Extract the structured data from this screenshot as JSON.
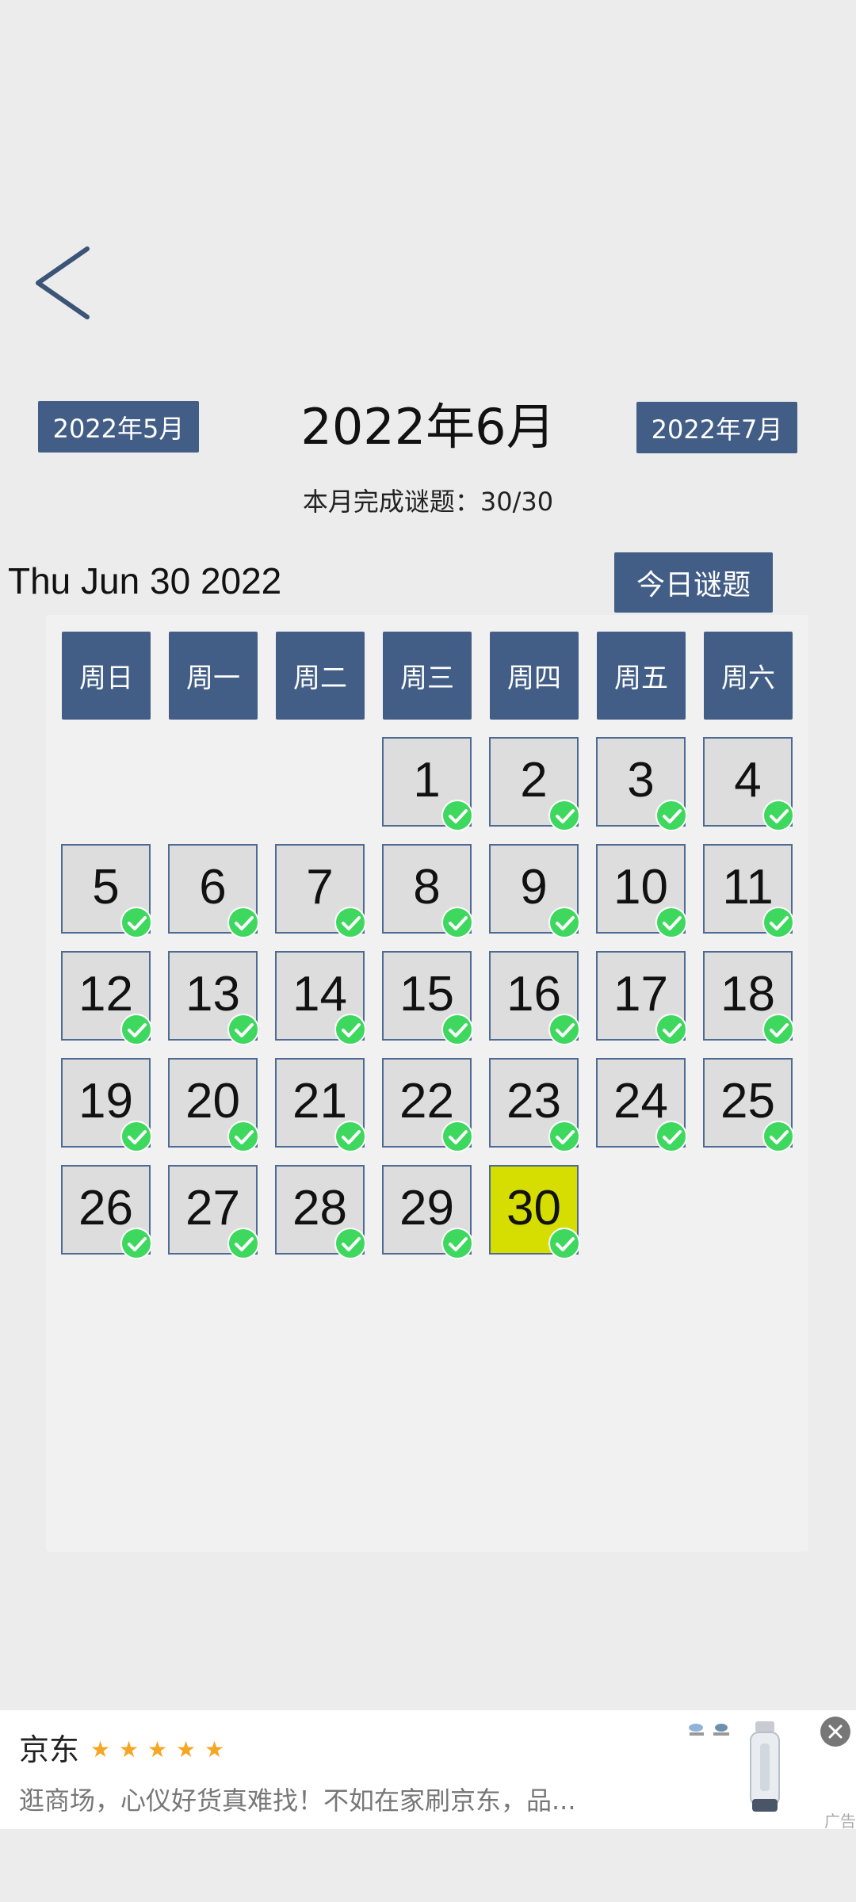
{
  "header": {
    "back_icon": "chevron-left-icon",
    "prev_month": "2022年5月",
    "next_month": "2022年7月",
    "month_title": "2022年6月",
    "progress_text": "本月完成谜题：30/30",
    "today_date": "Thu Jun 30 2022",
    "today_puzzle_button": "今日谜题"
  },
  "calendar": {
    "weekdays": [
      "周日",
      "周一",
      "周二",
      "周三",
      "周四",
      "周五",
      "周六"
    ],
    "first_weekday_index": 3,
    "days": [
      {
        "day": "1",
        "completed": true
      },
      {
        "day": "2",
        "completed": true
      },
      {
        "day": "3",
        "completed": true
      },
      {
        "day": "4",
        "completed": true
      },
      {
        "day": "5",
        "completed": true
      },
      {
        "day": "6",
        "completed": true
      },
      {
        "day": "7",
        "completed": true
      },
      {
        "day": "8",
        "completed": true
      },
      {
        "day": "9",
        "completed": true
      },
      {
        "day": "10",
        "completed": true
      },
      {
        "day": "11",
        "completed": true
      },
      {
        "day": "12",
        "completed": true
      },
      {
        "day": "13",
        "completed": true
      },
      {
        "day": "14",
        "completed": true
      },
      {
        "day": "15",
        "completed": true
      },
      {
        "day": "16",
        "completed": true
      },
      {
        "day": "17",
        "completed": true
      },
      {
        "day": "18",
        "completed": true
      },
      {
        "day": "19",
        "completed": true
      },
      {
        "day": "20",
        "completed": true
      },
      {
        "day": "21",
        "completed": true
      },
      {
        "day": "22",
        "completed": true
      },
      {
        "day": "23",
        "completed": true
      },
      {
        "day": "24",
        "completed": true
      },
      {
        "day": "25",
        "completed": true
      },
      {
        "day": "26",
        "completed": true
      },
      {
        "day": "27",
        "completed": true
      },
      {
        "day": "28",
        "completed": true
      },
      {
        "day": "29",
        "completed": true
      },
      {
        "day": "30",
        "completed": true,
        "today": true
      }
    ],
    "check_icon": "check-circle-icon"
  },
  "ad": {
    "brand": "京东",
    "rating_stars": 5,
    "text": "逛商场，心仪好货真难找！不如在家刷京东，品...",
    "label": "广告",
    "close_icon": "close-icon",
    "product_image": "bottle-product-icon"
  },
  "colors": {
    "accent": "#435e86",
    "today_highlight": "#d6dd00",
    "check_green": "#3ed85f",
    "star": "#f5a623"
  }
}
